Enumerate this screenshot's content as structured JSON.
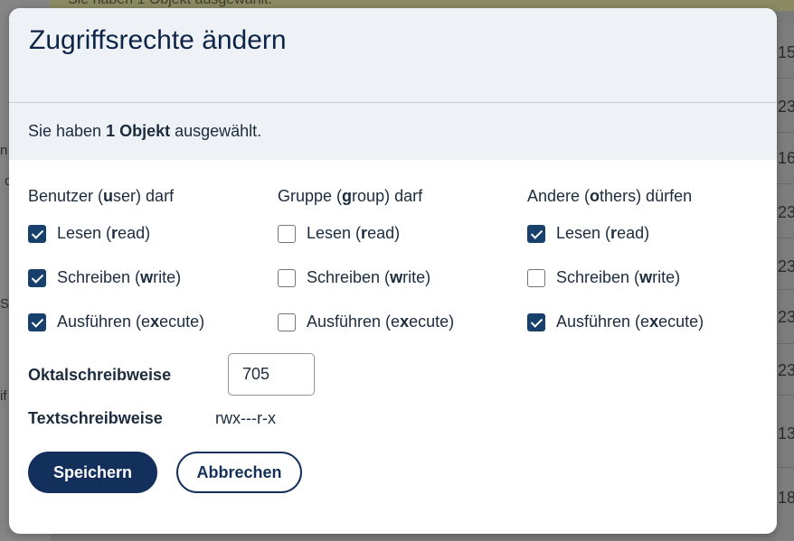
{
  "background": {
    "banner_text": "Sie haben 1 Objekt ausgewählt.",
    "left_fragments": [
      "n",
      "c",
      "Sh",
      "if"
    ],
    "row_numbers": [
      "15",
      "23",
      "16",
      "23",
      "23",
      "23",
      "23",
      "13",
      "18"
    ]
  },
  "dialog": {
    "title": "Zugriffsrechte ändern",
    "selection": {
      "prefix": "Sie haben",
      "count_text": "1 Objekt",
      "suffix": "ausgewählt."
    },
    "columns": [
      {
        "head_pre": "Benutzer (",
        "head_key": "u",
        "head_post": "ser) darf",
        "read": {
          "pre": "Lesen (",
          "key": "r",
          "post": "ead)",
          "checked": true
        },
        "write": {
          "pre": "Schreiben (",
          "key": "w",
          "post": "rite)",
          "checked": true
        },
        "execute": {
          "pre": "Ausführen (e",
          "key": "x",
          "post": "ecute)",
          "checked": true
        }
      },
      {
        "head_pre": "Gruppe (",
        "head_key": "g",
        "head_post": "roup) darf",
        "read": {
          "pre": "Lesen (",
          "key": "r",
          "post": "ead)",
          "checked": false
        },
        "write": {
          "pre": "Schreiben (",
          "key": "w",
          "post": "rite)",
          "checked": false
        },
        "execute": {
          "pre": "Ausführen (e",
          "key": "x",
          "post": "ecute)",
          "checked": false
        }
      },
      {
        "head_pre": "Andere (",
        "head_key": "o",
        "head_post": "thers) dürfen",
        "read": {
          "pre": "Lesen (",
          "key": "r",
          "post": "ead)",
          "checked": true
        },
        "write": {
          "pre": "Schreiben (",
          "key": "w",
          "post": "rite)",
          "checked": false
        },
        "execute": {
          "pre": "Ausführen (e",
          "key": "x",
          "post": "ecute)",
          "checked": true
        }
      }
    ],
    "octal": {
      "label": "Oktalschreibweise",
      "value": "705"
    },
    "text": {
      "label": "Textschreibweise",
      "value": "rwx---r-x"
    },
    "buttons": {
      "save": "Speichern",
      "cancel": "Abbrechen"
    }
  },
  "colors": {
    "primary": "#132f5c",
    "checkbox_checked": "#17406d",
    "header_bg": "#eef2f6",
    "text": "#1c2b3e"
  }
}
